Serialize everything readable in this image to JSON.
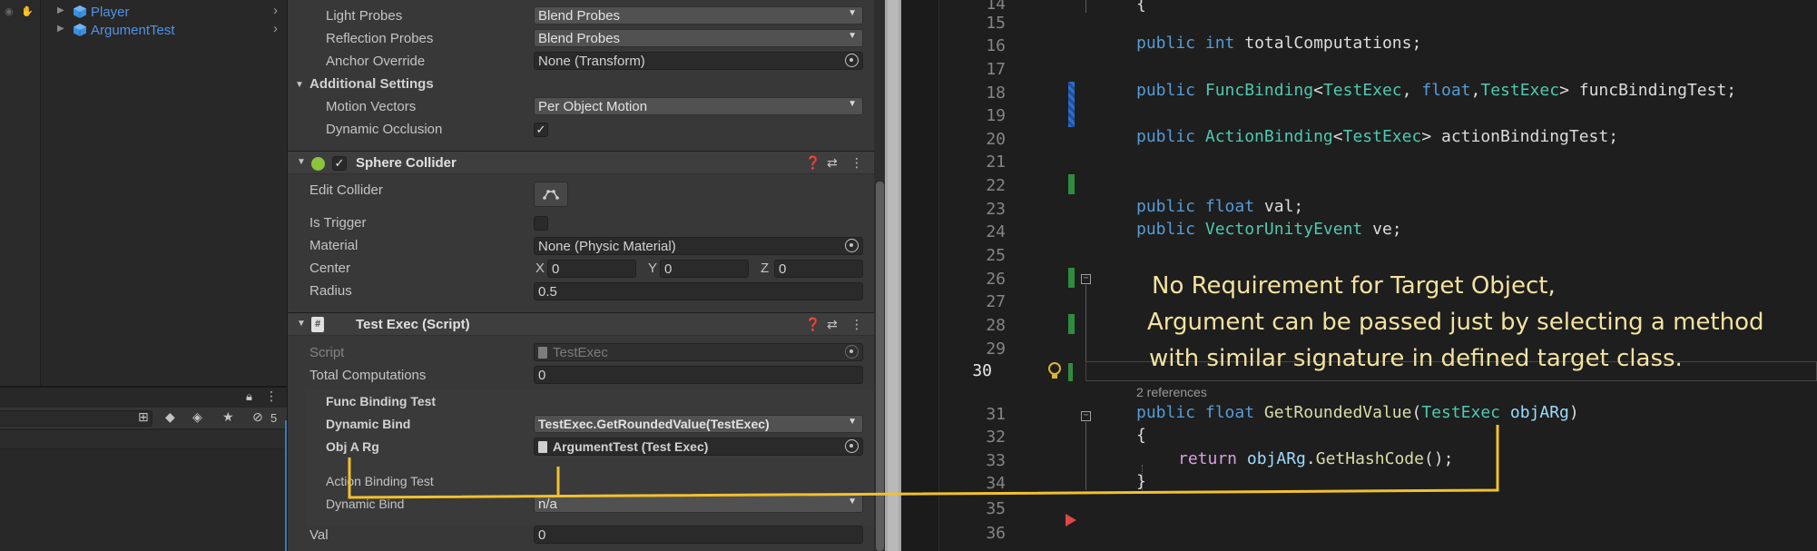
{
  "hierarchy": {
    "items": [
      {
        "label": "Player"
      },
      {
        "label": "ArgumentTest"
      }
    ]
  },
  "project": {
    "count": "5",
    "search_placeholder": ""
  },
  "inspector": {
    "renderer": {
      "light_probes_label": "Light Probes",
      "light_probes_value": "Blend Probes",
      "reflection_probes_label": "Reflection Probes",
      "reflection_probes_value": "Blend Probes",
      "anchor_override_label": "Anchor Override",
      "anchor_override_value": "None (Transform)",
      "additional_settings_label": "Additional Settings",
      "motion_vectors_label": "Motion Vectors",
      "motion_vectors_value": "Per Object Motion",
      "dynamic_occlusion_label": "Dynamic Occlusion",
      "dynamic_occlusion_checked": "✓"
    },
    "sphere_collider": {
      "title": "Sphere Collider",
      "enabled_mark": "✓",
      "edit_collider_label": "Edit Collider",
      "is_trigger_label": "Is Trigger",
      "material_label": "Material",
      "material_value": "None (Physic Material)",
      "center_label": "Center",
      "center_x_label": "X",
      "center_x": "0",
      "center_y_label": "Y",
      "center_y": "0",
      "center_z_label": "Z",
      "center_z": "0",
      "radius_label": "Radius",
      "radius_value": "0.5"
    },
    "test_exec": {
      "title": "Test Exec (Script)",
      "script_label": "Script",
      "script_value": "TestExec",
      "total_computations_label": "Total Computations",
      "total_computations_value": "0",
      "func_binding_label": "Func Binding Test",
      "dynamic_bind_label": "Dynamic Bind",
      "dynamic_bind_value": "TestExec.GetRoundedValue(TestExec)",
      "obj_arg_label": "Obj A Rg",
      "obj_arg_value": "ArgumentTest (Test Exec)",
      "action_binding_label": "Action Binding Test",
      "action_dynamic_bind_label": "Dynamic Bind",
      "action_dynamic_bind_value": "n/a",
      "val_label": "Val",
      "val_value": "0"
    }
  },
  "editor": {
    "line_numbers": [
      "14",
      "15",
      "16",
      "17",
      "18",
      "19",
      "20",
      "21",
      "22",
      "23",
      "24",
      "25",
      "26",
      "27",
      "28",
      "29",
      "30",
      "31",
      "32",
      "33",
      "34",
      "35",
      "36"
    ],
    "current_line": "30",
    "codelens": "2 references",
    "annotation": [
      "No Requirement for Target Object,",
      "Argument can be passed just by selecting a method",
      "with similar signature in defined target class."
    ],
    "lines": {
      "l16": {
        "kw1": "public",
        "kw2": "int",
        "rest": " totalComputations;"
      },
      "l18": {
        "kw1": "public",
        "ty1": "FuncBinding",
        "p1": "<",
        "ty2": "TestExec",
        "p2": ", ",
        "kw2": "float",
        "p3": ",",
        "ty3": "TestExec",
        "p4": "> funcBindingTest;"
      },
      "l20": {
        "kw1": "public",
        "ty1": "ActionBinding",
        "p1": "<",
        "ty2": "TestExec",
        "p2": "> actionBindingTest;"
      },
      "l23": {
        "kw1": "public",
        "kw2": "float",
        "rest": " val;"
      },
      "l24": {
        "kw1": "public",
        "ty1": "VectorUnityEvent",
        "rest": " ve;"
      },
      "l31": {
        "kw1": "public",
        "kw2": "float",
        "fn": "GetRoundedValue",
        "p1": "(",
        "ty1": "TestExec",
        "pa": "objARg",
        "p2": ")"
      },
      "l32": {
        "text": "{"
      },
      "l33": {
        "cf": "return",
        "pa": "objARg",
        "p1": ".",
        "fn": "GetHashCode",
        "p2": "();"
      },
      "l34": {
        "text": "}"
      }
    }
  },
  "colors": {
    "annotation_text": "#f3e2a0",
    "connector_line": "#f2c12e",
    "keyword": "#569cd6",
    "type": "#4ec9b0",
    "method": "#dcdcaa"
  }
}
